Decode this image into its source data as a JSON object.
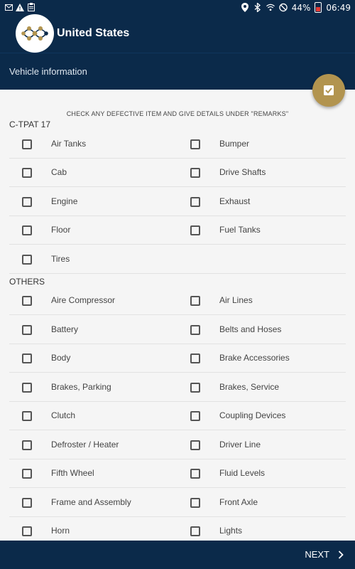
{
  "status_bar": {
    "battery_percent": "44%",
    "time": "06:49",
    "left_icons": [
      "mail-icon",
      "warning-icon",
      "clipboard-icon"
    ],
    "right_icons": [
      "location-icon",
      "bluetooth-icon",
      "wifi-icon",
      "do-not-disturb-icon",
      "battery-icon"
    ]
  },
  "header": {
    "title": "United States"
  },
  "subheader": {
    "title": "Vehicle information"
  },
  "fab": {
    "icon": "checkbox-icon"
  },
  "instruction": "CHECK ANY DEFECTIVE ITEM AND GIVE DETAILS UNDER \"REMARKS\"",
  "sections": [
    {
      "title": "C-TPAT 17",
      "rows": [
        [
          "Air Tanks",
          "Bumper"
        ],
        [
          "Cab",
          "Drive Shafts"
        ],
        [
          "Engine",
          "Exhaust"
        ],
        [
          "Floor",
          "Fuel Tanks"
        ],
        [
          "Tires",
          null
        ]
      ]
    },
    {
      "title": "OTHERS",
      "rows": [
        [
          "Aire Compressor",
          "Air Lines"
        ],
        [
          "Battery",
          "Belts and Hoses"
        ],
        [
          "Body",
          "Brake Accessories"
        ],
        [
          "Brakes, Parking",
          "Brakes, Service"
        ],
        [
          "Clutch",
          "Coupling Devices"
        ],
        [
          "Defroster / Heater",
          "Driver Line"
        ],
        [
          "Fifth Wheel",
          "Fluid Levels"
        ],
        [
          "Frame and Assembly",
          "Front Axle"
        ],
        [
          "Horn",
          "Lights"
        ]
      ]
    }
  ],
  "footer": {
    "next_label": "NEXT"
  },
  "colors": {
    "primary": "#0b2a4a",
    "accent": "#b2944f"
  }
}
